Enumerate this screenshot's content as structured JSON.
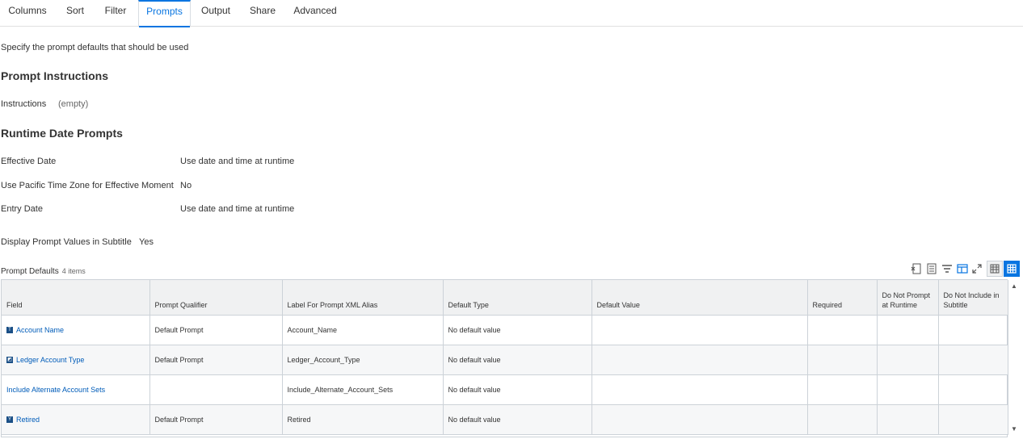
{
  "tabs": [
    "Columns",
    "Sort",
    "Filter",
    "Prompts",
    "Output",
    "Share",
    "Advanced"
  ],
  "active_tab": "Prompts",
  "intro_text": "Specify the prompt defaults that should be used",
  "prompt_instructions": {
    "heading": "Prompt Instructions",
    "label": "Instructions",
    "value": "(empty)"
  },
  "runtime_date_prompts": {
    "heading": "Runtime Date Prompts",
    "fields": [
      {
        "label": "Effective Date",
        "value": "Use date and time at runtime"
      },
      {
        "label": "Use Pacific Time Zone for Effective Moment",
        "value": "No"
      },
      {
        "label": "Entry Date",
        "value": "Use date and time at runtime"
      }
    ]
  },
  "display_prompt_values": {
    "label": "Display Prompt Values in Subtitle",
    "value": "Yes"
  },
  "prompt_defaults": {
    "title": "Prompt Defaults",
    "count": "4 items",
    "columns": [
      "Field",
      "Prompt Qualifier",
      "Label For Prompt XML Alias",
      "Default Type",
      "Default Value",
      "Required",
      "Do Not Prompt at Runtime",
      "Do Not Include in Subtitle"
    ],
    "rows": [
      {
        "field": "Account Name",
        "icon": "text-field-icon",
        "qualifier": "Default Prompt",
        "alias": "Account_Name",
        "default_type": "No default value",
        "default_value": "",
        "required": "",
        "no_prompt": "",
        "no_subtitle": ""
      },
      {
        "field": "Ledger Account Type",
        "icon": "single-instance-icon",
        "qualifier": "Default Prompt",
        "alias": "Ledger_Account_Type",
        "default_type": "No default value",
        "default_value": "",
        "required": "",
        "no_prompt": "",
        "no_subtitle": ""
      },
      {
        "field": "Include Alternate Account Sets",
        "icon": "",
        "qualifier": "",
        "alias": "Include_Alternate_Account_Sets",
        "default_type": "No default value",
        "default_value": "",
        "required": "",
        "no_prompt": "",
        "no_subtitle": ""
      },
      {
        "field": "Retired",
        "icon": "boolean-field-icon",
        "qualifier": "Default Prompt",
        "alias": "Retired",
        "default_type": "No default value",
        "default_value": "",
        "required": "",
        "no_prompt": "",
        "no_subtitle": ""
      }
    ]
  },
  "colors": {
    "accent": "#0875e1",
    "link": "#005cb9",
    "header_bg": "#f0f1f2",
    "border": "#ccd2d8"
  }
}
